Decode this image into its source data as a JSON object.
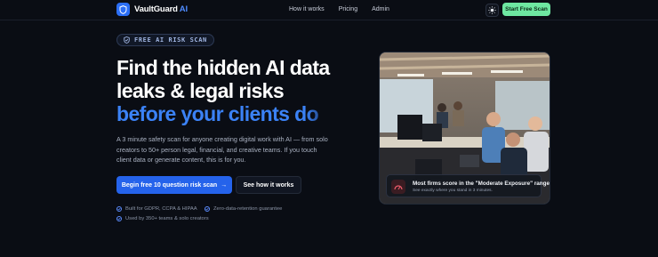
{
  "brand": {
    "name": "VaultGuard",
    "suffix": "AI"
  },
  "nav": {
    "links": [
      "How it works",
      "Pricing",
      "Admin"
    ],
    "cta": "Start Free Scan"
  },
  "hero": {
    "badge": "FREE AI RISK SCAN",
    "headline": [
      "Find the hidden AI data",
      "leaks & legal risks"
    ],
    "headline_accent": "before your clients do",
    "description": "A 3 minute safety scan for anyone creating digital work with AI — from solo creators to 50+ person legal, financial, and creative teams. If you touch client data or generate content, this is for you.",
    "primary_cta": "Begin free 10 question risk scan",
    "primary_cta_arrow": "→",
    "secondary_cta": "See how it works",
    "trust": [
      "Built for GDPR, CCPA & HIPAA",
      "Zero-data-retention guarantee",
      "Used by 350+ teams & solo creators"
    ]
  },
  "overlay": {
    "title": "Most firms score in the \"Moderate Exposure\" range",
    "subtitle": "See exactly where you stand in 3 minutes."
  },
  "colors": {
    "accent": "#2563eb",
    "cta_green": "#6ee7a1",
    "background": "#0a0d14"
  }
}
